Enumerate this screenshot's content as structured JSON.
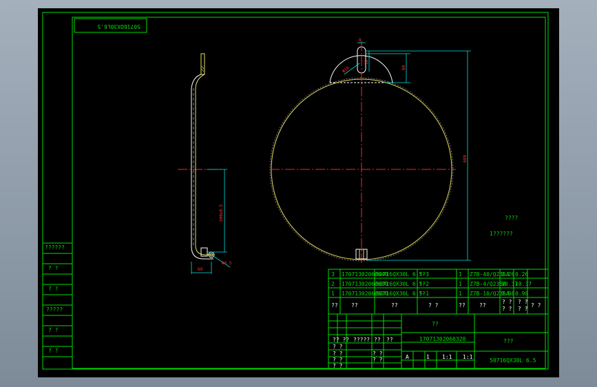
{
  "drawing": {
    "stamp": "50716OX30L6.5",
    "title": "??",
    "drawing_no": "17071302060320",
    "material": "???",
    "model": "50716QX30L 6.5",
    "note_label": "????",
    "note_item": "1??????"
  },
  "dimensions": {
    "slot_width": "8",
    "slot_height": "18",
    "diameter_small": "Φ16",
    "height_top": "60",
    "height_total": "689",
    "side_length": "300±0.5",
    "side_bottom": "69",
    "side_tag": "Φ6.5"
  },
  "left_strip": [
    "??????",
    "? ?",
    "? ?",
    "?????",
    "? ?",
    "? ?"
  ],
  "bom": {
    "rows": [
      [
        "3",
        "17071302060640",
        "50716QX30L 6.5-3",
        "??",
        "1",
        "Z7B-40/Q235A",
        "0.26",
        "0.26"
      ],
      [
        "2",
        "17071302060680",
        "50716QX30L 6.5-2",
        "??",
        "1",
        "Z7B-4/Q235A",
        "10.37",
        "10.37"
      ],
      [
        "1",
        "17071302060670",
        "50716QX30L 6.5-1",
        "??",
        "1",
        "Z7B-10/Q235A",
        "0.98",
        "0.98"
      ]
    ],
    "header": [
      "??",
      "??",
      "??",
      "? ?",
      "??",
      "??",
      "? ?\n? ?",
      "? ?"
    ]
  },
  "title_block": {
    "cells": [
      "??",
      "?? ??",
      "?????",
      "??",
      "??",
      "? ?",
      "? ?",
      "? ?",
      "? ?",
      "? ?",
      "? ?",
      "A",
      "1",
      "1:1",
      "1:1"
    ]
  }
}
